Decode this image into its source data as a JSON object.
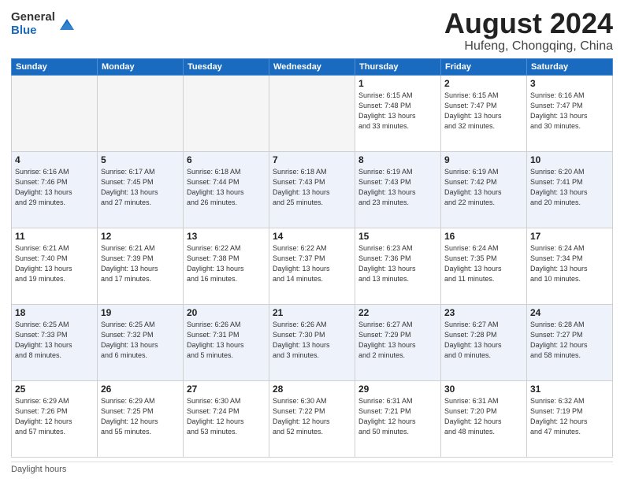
{
  "logo": {
    "general": "General",
    "blue": "Blue"
  },
  "title": "August 2024",
  "subtitle": "Hufeng, Chongqing, China",
  "headers": [
    "Sunday",
    "Monday",
    "Tuesday",
    "Wednesday",
    "Thursday",
    "Friday",
    "Saturday"
  ],
  "weeks": [
    [
      {
        "day": "",
        "info": ""
      },
      {
        "day": "",
        "info": ""
      },
      {
        "day": "",
        "info": ""
      },
      {
        "day": "",
        "info": ""
      },
      {
        "day": "1",
        "info": "Sunrise: 6:15 AM\nSunset: 7:48 PM\nDaylight: 13 hours\nand 33 minutes."
      },
      {
        "day": "2",
        "info": "Sunrise: 6:15 AM\nSunset: 7:47 PM\nDaylight: 13 hours\nand 32 minutes."
      },
      {
        "day": "3",
        "info": "Sunrise: 6:16 AM\nSunset: 7:47 PM\nDaylight: 13 hours\nand 30 minutes."
      }
    ],
    [
      {
        "day": "4",
        "info": "Sunrise: 6:16 AM\nSunset: 7:46 PM\nDaylight: 13 hours\nand 29 minutes."
      },
      {
        "day": "5",
        "info": "Sunrise: 6:17 AM\nSunset: 7:45 PM\nDaylight: 13 hours\nand 27 minutes."
      },
      {
        "day": "6",
        "info": "Sunrise: 6:18 AM\nSunset: 7:44 PM\nDaylight: 13 hours\nand 26 minutes."
      },
      {
        "day": "7",
        "info": "Sunrise: 6:18 AM\nSunset: 7:43 PM\nDaylight: 13 hours\nand 25 minutes."
      },
      {
        "day": "8",
        "info": "Sunrise: 6:19 AM\nSunset: 7:43 PM\nDaylight: 13 hours\nand 23 minutes."
      },
      {
        "day": "9",
        "info": "Sunrise: 6:19 AM\nSunset: 7:42 PM\nDaylight: 13 hours\nand 22 minutes."
      },
      {
        "day": "10",
        "info": "Sunrise: 6:20 AM\nSunset: 7:41 PM\nDaylight: 13 hours\nand 20 minutes."
      }
    ],
    [
      {
        "day": "11",
        "info": "Sunrise: 6:21 AM\nSunset: 7:40 PM\nDaylight: 13 hours\nand 19 minutes."
      },
      {
        "day": "12",
        "info": "Sunrise: 6:21 AM\nSunset: 7:39 PM\nDaylight: 13 hours\nand 17 minutes."
      },
      {
        "day": "13",
        "info": "Sunrise: 6:22 AM\nSunset: 7:38 PM\nDaylight: 13 hours\nand 16 minutes."
      },
      {
        "day": "14",
        "info": "Sunrise: 6:22 AM\nSunset: 7:37 PM\nDaylight: 13 hours\nand 14 minutes."
      },
      {
        "day": "15",
        "info": "Sunrise: 6:23 AM\nSunset: 7:36 PM\nDaylight: 13 hours\nand 13 minutes."
      },
      {
        "day": "16",
        "info": "Sunrise: 6:24 AM\nSunset: 7:35 PM\nDaylight: 13 hours\nand 11 minutes."
      },
      {
        "day": "17",
        "info": "Sunrise: 6:24 AM\nSunset: 7:34 PM\nDaylight: 13 hours\nand 10 minutes."
      }
    ],
    [
      {
        "day": "18",
        "info": "Sunrise: 6:25 AM\nSunset: 7:33 PM\nDaylight: 13 hours\nand 8 minutes."
      },
      {
        "day": "19",
        "info": "Sunrise: 6:25 AM\nSunset: 7:32 PM\nDaylight: 13 hours\nand 6 minutes."
      },
      {
        "day": "20",
        "info": "Sunrise: 6:26 AM\nSunset: 7:31 PM\nDaylight: 13 hours\nand 5 minutes."
      },
      {
        "day": "21",
        "info": "Sunrise: 6:26 AM\nSunset: 7:30 PM\nDaylight: 13 hours\nand 3 minutes."
      },
      {
        "day": "22",
        "info": "Sunrise: 6:27 AM\nSunset: 7:29 PM\nDaylight: 13 hours\nand 2 minutes."
      },
      {
        "day": "23",
        "info": "Sunrise: 6:27 AM\nSunset: 7:28 PM\nDaylight: 13 hours\nand 0 minutes."
      },
      {
        "day": "24",
        "info": "Sunrise: 6:28 AM\nSunset: 7:27 PM\nDaylight: 12 hours\nand 58 minutes."
      }
    ],
    [
      {
        "day": "25",
        "info": "Sunrise: 6:29 AM\nSunset: 7:26 PM\nDaylight: 12 hours\nand 57 minutes."
      },
      {
        "day": "26",
        "info": "Sunrise: 6:29 AM\nSunset: 7:25 PM\nDaylight: 12 hours\nand 55 minutes."
      },
      {
        "day": "27",
        "info": "Sunrise: 6:30 AM\nSunset: 7:24 PM\nDaylight: 12 hours\nand 53 minutes."
      },
      {
        "day": "28",
        "info": "Sunrise: 6:30 AM\nSunset: 7:22 PM\nDaylight: 12 hours\nand 52 minutes."
      },
      {
        "day": "29",
        "info": "Sunrise: 6:31 AM\nSunset: 7:21 PM\nDaylight: 12 hours\nand 50 minutes."
      },
      {
        "day": "30",
        "info": "Sunrise: 6:31 AM\nSunset: 7:20 PM\nDaylight: 12 hours\nand 48 minutes."
      },
      {
        "day": "31",
        "info": "Sunrise: 6:32 AM\nSunset: 7:19 PM\nDaylight: 12 hours\nand 47 minutes."
      }
    ]
  ],
  "footer": {
    "daylight_label": "Daylight hours"
  }
}
